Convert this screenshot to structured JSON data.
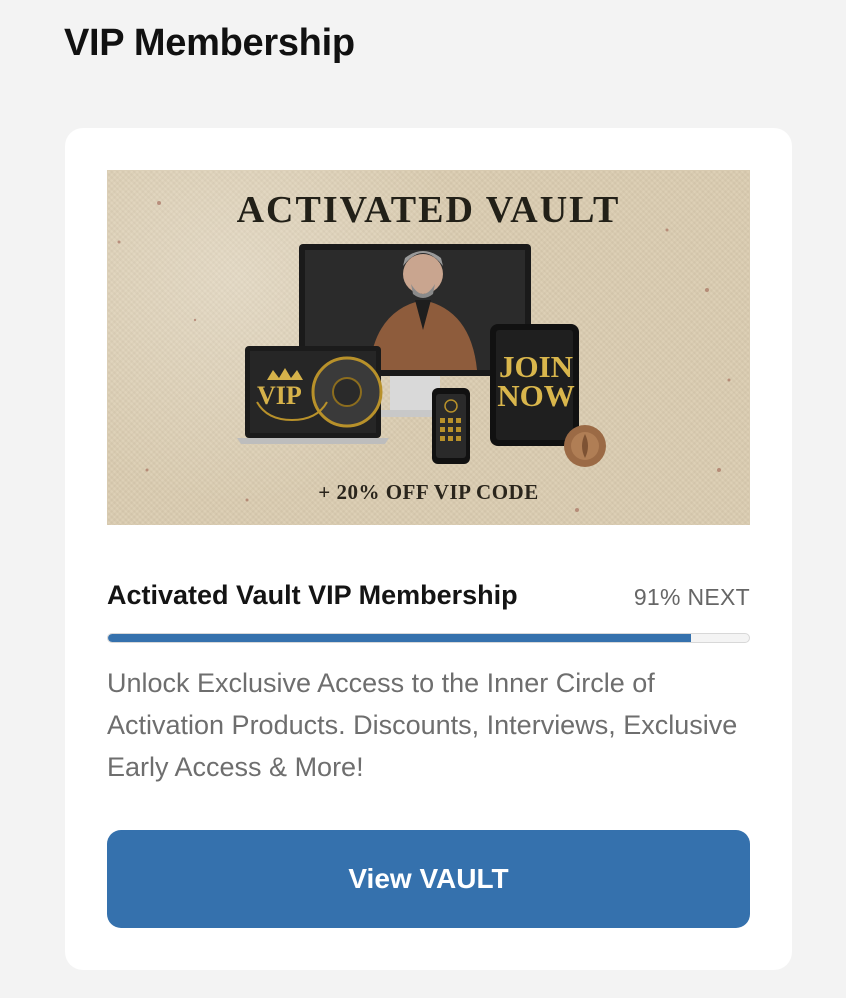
{
  "header": {
    "title": "VIP Membership"
  },
  "card": {
    "banner": {
      "title": "ACTIVATED VAULT",
      "laptop_badge": "VIP",
      "tablet_text": "JOIN NOW",
      "promo": "+ 20% OFF VIP CODE",
      "icons": [
        "laptop-icon",
        "monitor-icon",
        "phone-icon",
        "tablet-icon",
        "wax-seal-icon",
        "crown-icon"
      ]
    },
    "product_title": "Activated Vault VIP Membership",
    "progress": {
      "label": "91% NEXT",
      "percent": 91
    },
    "description": "Unlock Exclusive Access to the Inner Circle of Activation Products. Discounts, Interviews, Exclusive Early Access & More!",
    "button_label": "View VAULT"
  },
  "colors": {
    "accent": "#3571ad",
    "background": "#f3f3f3",
    "card": "#ffffff",
    "banner_bg": "#ddd0b6",
    "gold": "#d6b24a"
  }
}
